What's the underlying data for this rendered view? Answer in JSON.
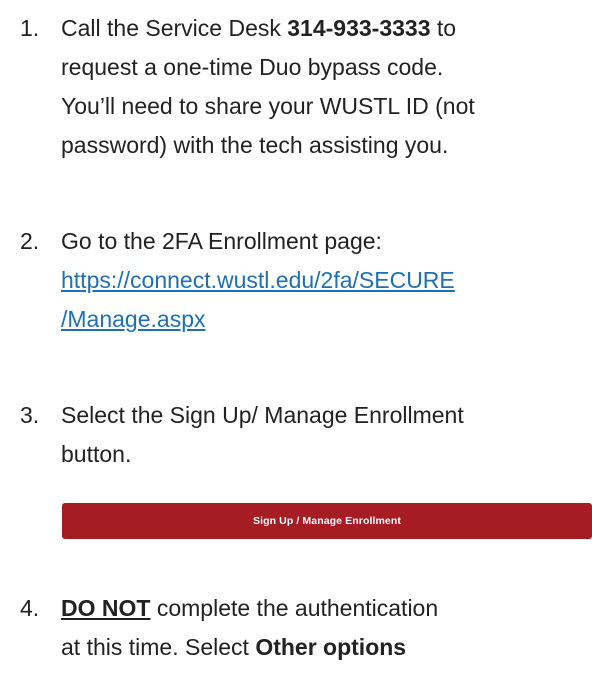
{
  "steps": [
    {
      "number": "1.",
      "line1_a": "Call the Service Desk ",
      "line1_bold": "314-933-3333",
      "line1_b": " to",
      "line2": "request a one-time Duo bypass code.",
      "line3": "You’ll need to share your WUSTL ID (not",
      "line4": "password) with the tech assisting you."
    },
    {
      "number": "2.",
      "line1": "Go to the 2FA Enrollment page:",
      "link_line1": "https://connect.wustl.edu/2fa/SECURE",
      "link_line2": "/Manage.aspx"
    },
    {
      "number": "3.",
      "line1": "Select the Sign Up/ Manage Enrollment",
      "line2": "button.",
      "button_label": "Sign Up / Manage Enrollment"
    },
    {
      "number": "4.",
      "line1_bold_u": "DO NOT",
      "line1_rest": " complete the authentication",
      "line2_a": "at this time. Select ",
      "line2_bold": "Other options"
    }
  ],
  "colors": {
    "link": "#1f6fb5",
    "button_bg": "#a51c22",
    "button_text": "#ffffff"
  }
}
